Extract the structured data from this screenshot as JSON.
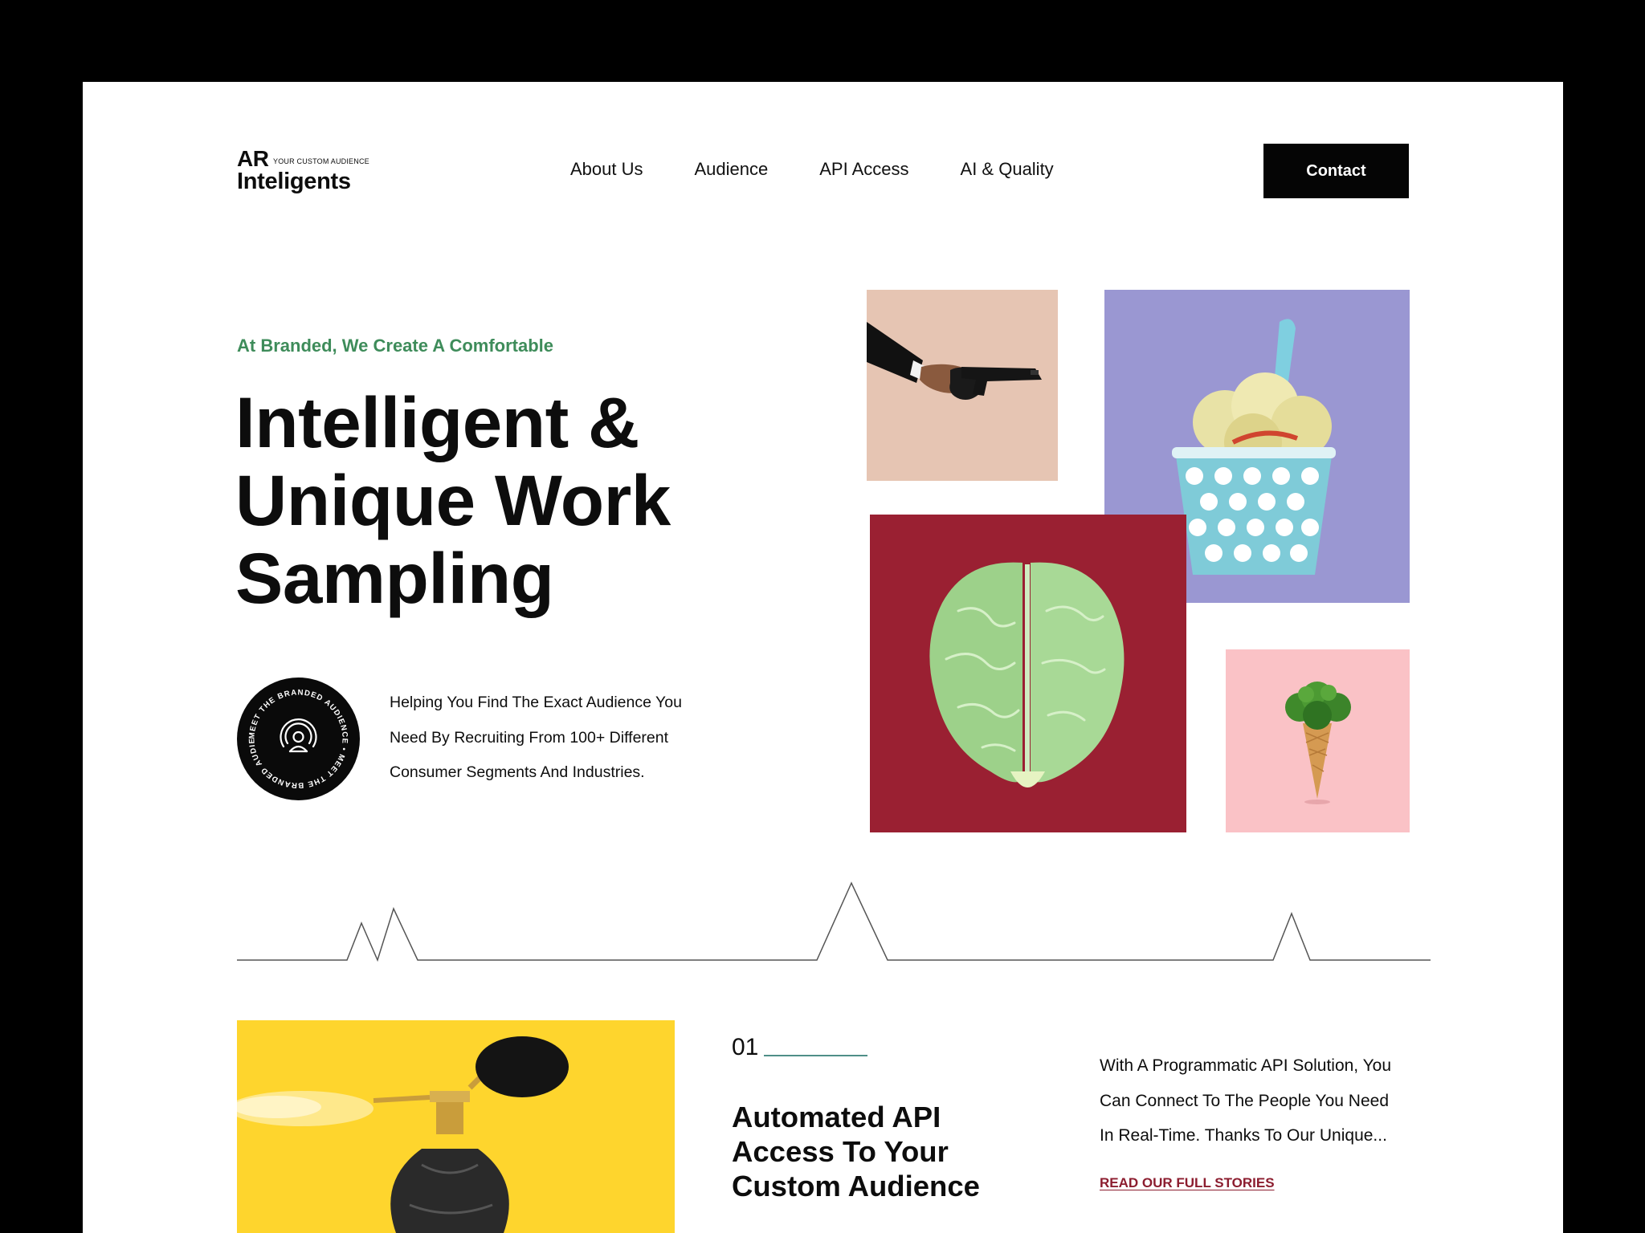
{
  "brand": {
    "mark": "AR",
    "tagline": "YOUR CUSTOM AUDIENCE",
    "name": "Inteligents"
  },
  "nav": {
    "items": [
      "About Us",
      "Audience",
      "API Access",
      "AI & Quality"
    ],
    "contact_label": "Contact"
  },
  "hero": {
    "eyebrow": "At Branded, We Create A Comfortable",
    "title_lines": [
      "Intelligent &",
      "Unique Work",
      "Sampling"
    ],
    "badge_text": "MEET THE BRANDED AUDIENCE • MEET THE BRANDED AUDIENCE •",
    "badge_icon": "broadcast-person-icon",
    "description_lines": [
      "Helping You Find The Exact Audience You",
      "Need By Recruiting From 100+ Different",
      "Consumer Segments And Industries."
    ]
  },
  "gallery": {
    "tiles": [
      {
        "subject": "handshake-gun-image",
        "bg": "#e6c5b3"
      },
      {
        "subject": "cauliflower-ice-cream-image",
        "bg": "#9a97d2"
      },
      {
        "subject": "cabbage-brain-image",
        "bg": "#9a2032"
      },
      {
        "subject": "broccoli-cone-image",
        "bg": "#fac2c6"
      }
    ]
  },
  "feature": {
    "number": "01",
    "title_lines": [
      "Automated API",
      "Access To Your",
      "Custom Audience"
    ],
    "description_lines": [
      "With A Programmatic API Solution, You",
      "Can Connect To The People You Need",
      "In Real-Time. Thanks To Our Unique..."
    ],
    "link_label": "READ OUR FULL STORIES",
    "image_subject": "perfume-bag-image",
    "image_bg": "#fed52d"
  },
  "colors": {
    "accent_green": "#3e8c5a",
    "link_red": "#8c1d2f",
    "button_black": "#050505",
    "rule_teal": "#4f8f88"
  }
}
